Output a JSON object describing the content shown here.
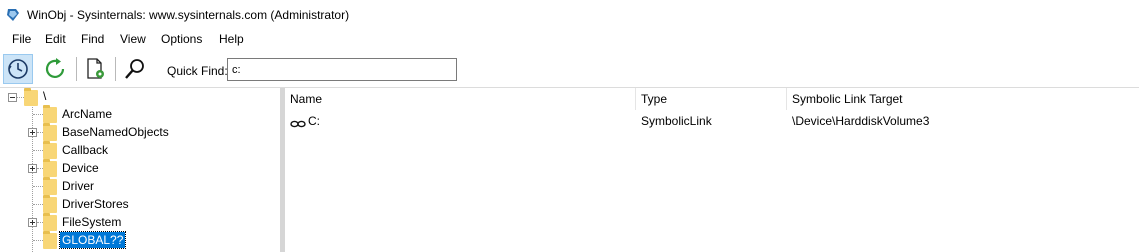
{
  "window": {
    "title": "WinObj - Sysinternals: www.sysinternals.com (Administrator)"
  },
  "menu": {
    "items": [
      "File",
      "Edit",
      "Find",
      "View",
      "Options",
      "Help"
    ]
  },
  "toolbar": {
    "buttons": [
      "clock-icon",
      "refresh-icon",
      "properties-icon",
      "find-icon"
    ],
    "quick_find_label": "Quick Find:",
    "quick_find_value": "c:"
  },
  "tree": {
    "root": "\\",
    "items": [
      {
        "label": "ArcName",
        "expandable": false,
        "selected": false
      },
      {
        "label": "BaseNamedObjects",
        "expandable": true,
        "selected": false
      },
      {
        "label": "Callback",
        "expandable": false,
        "selected": false
      },
      {
        "label": "Device",
        "expandable": true,
        "selected": false
      },
      {
        "label": "Driver",
        "expandable": false,
        "selected": false
      },
      {
        "label": "DriverStores",
        "expandable": false,
        "selected": false
      },
      {
        "label": "FileSystem",
        "expandable": true,
        "selected": false
      },
      {
        "label": "GLOBAL??",
        "expandable": false,
        "selected": true
      }
    ]
  },
  "list": {
    "columns": [
      "Name",
      "Type",
      "Symbolic Link Target"
    ],
    "rows": [
      {
        "name": "C:",
        "type": "SymbolicLink",
        "target": "\\Device\\HarddiskVolume3",
        "icon": "symlink-icon"
      }
    ]
  },
  "colors": {
    "selection": "#0078d7",
    "folder": "#f8d676",
    "pressed_button": "#cce4f7"
  }
}
